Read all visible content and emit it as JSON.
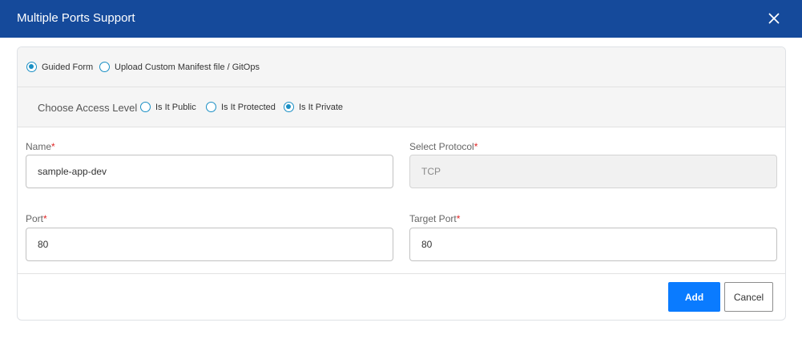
{
  "dialog": {
    "title": "Multiple Ports Support",
    "close_icon": "close-icon"
  },
  "mode": {
    "options": [
      {
        "label": "Guided Form",
        "checked": true
      },
      {
        "label": "Upload Custom Manifest file / GitOps",
        "checked": false
      }
    ]
  },
  "access": {
    "label": "Choose Access Level",
    "options": [
      {
        "label": "Is It Public",
        "checked": false
      },
      {
        "label": "Is It Protected",
        "checked": false
      },
      {
        "label": "Is It Private",
        "checked": true
      }
    ]
  },
  "form": {
    "name": {
      "label": "Name",
      "required_mark": "*",
      "value": "sample-app-dev"
    },
    "protocol": {
      "label": "Select Protocol",
      "required_mark": "*",
      "value": "TCP",
      "disabled": true
    },
    "port": {
      "label": "Port",
      "required_mark": "*",
      "value": "80"
    },
    "target_port": {
      "label": "Target Port",
      "required_mark": "*",
      "value": "80"
    }
  },
  "actions": {
    "add_label": "Add",
    "cancel_label": "Cancel"
  },
  "colors": {
    "header_bg": "#154a9b",
    "radio_accent": "#1a8fc4",
    "primary_button": "#0a7bff",
    "required": "#e02424"
  }
}
